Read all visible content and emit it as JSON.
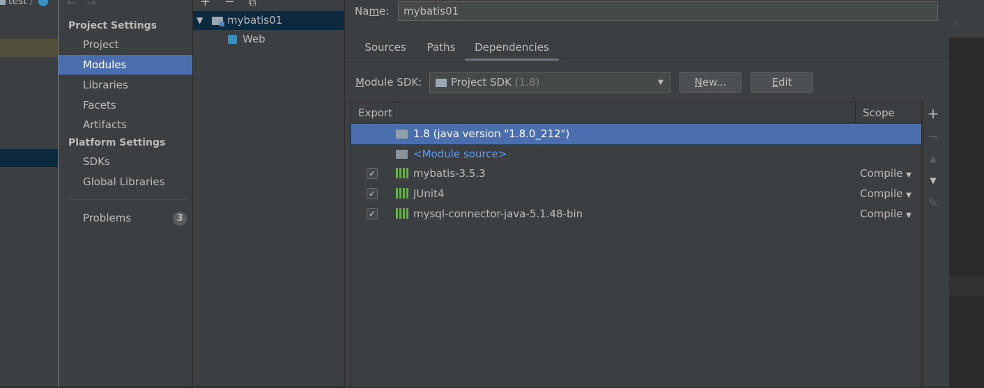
{
  "background_ide": {
    "tab_label": "test"
  },
  "toolbar": {
    "add": "+",
    "remove": "−",
    "copy": "⧉",
    "back": "←",
    "forward": "→"
  },
  "nav": {
    "project_settings_header": "Project Settings",
    "project_items": [
      "Project",
      "Modules",
      "Libraries",
      "Facets",
      "Artifacts"
    ],
    "platform_settings_header": "Platform Settings",
    "platform_items": [
      "SDKs",
      "Global Libraries"
    ],
    "problems_label": "Problems",
    "problems_count": "3",
    "selected": "Modules"
  },
  "tree": {
    "module_name": "mybatis01",
    "facet_name": "Web"
  },
  "module": {
    "name_label_prefix": "Na",
    "name_label_mnemonic": "m",
    "name_label_suffix": "e:",
    "name_value": "mybatis01"
  },
  "tabs": [
    "Sources",
    "Paths",
    "Dependencies"
  ],
  "active_tab": "Dependencies",
  "sdk": {
    "label_mnemonic": "M",
    "label_rest": "odule SDK:",
    "selected": "Project SDK",
    "selected_hint": "(1.8)",
    "new_button_mnemonic": "N",
    "new_button_rest": "ew...",
    "edit_button_mnemonic": "E",
    "edit_button_rest": "dit"
  },
  "table": {
    "col_export": "Export",
    "col_scope": "Scope",
    "rows": [
      {
        "name": "1.8 (java version \"1.8.0_212\")",
        "selected": true
      },
      {
        "name": "<Module source>"
      },
      {
        "name": "mybatis-3.5.3",
        "scope": "Compile",
        "checked": true
      },
      {
        "name": "JUnit4",
        "scope": "Compile",
        "checked": true
      },
      {
        "name": "mysql-connector-java-5.1.48-bin",
        "scope": "Compile",
        "checked": true
      }
    ]
  },
  "side_buttons": {
    "add": "+",
    "remove": "−",
    "up": "▲",
    "down": "▼",
    "edit": "✎"
  },
  "colors": {
    "selection": "#4b6eaf",
    "link": "#589df6",
    "panel": "#3c3f41",
    "dark": "#2b2b2b"
  }
}
